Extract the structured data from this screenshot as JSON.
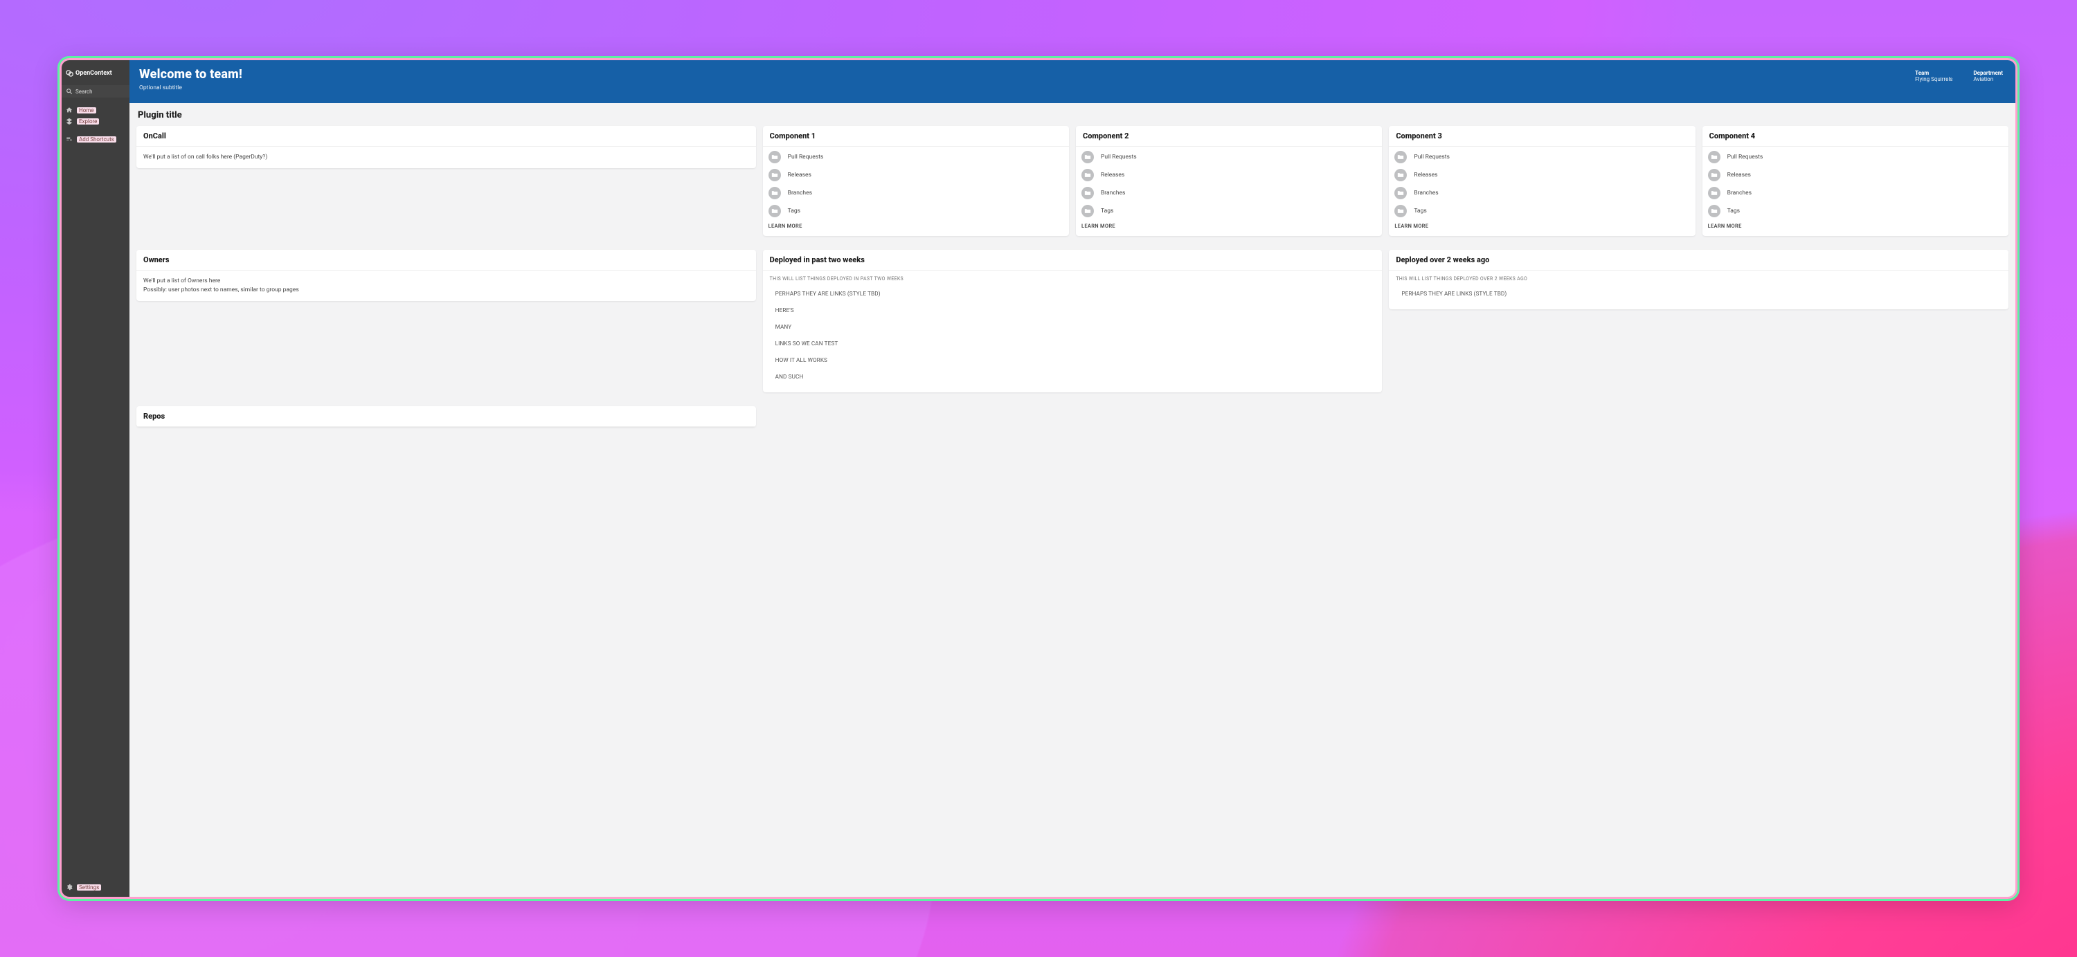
{
  "brand": {
    "name": "OpenContext"
  },
  "sidebar": {
    "search_label": "Search",
    "nav": [
      {
        "label": "Home"
      },
      {
        "label": "Explore"
      }
    ],
    "add_shortcuts": "Add Shortcuts",
    "settings": "Settings"
  },
  "header": {
    "title": "Welcome to team!",
    "subtitle": "Optional subtitle",
    "meta": [
      {
        "key": "Team",
        "value": "Flying Squirrels"
      },
      {
        "key": "Department",
        "value": "Aviation"
      }
    ]
  },
  "plugin_title": "Plugin title",
  "oncall": {
    "title": "OnCall",
    "body": "We'll put a list of on call folks here (PagerDuty?)"
  },
  "component_row_labels": {
    "pull_requests": "Pull Requests",
    "releases": "Releases",
    "branches": "Branches",
    "tags": "Tags"
  },
  "learn_more": "LEARN MORE",
  "components": [
    {
      "title": "Component 1"
    },
    {
      "title": "Component 2"
    },
    {
      "title": "Component 3"
    },
    {
      "title": "Component 4"
    }
  ],
  "owners": {
    "title": "Owners",
    "body1": "We'll put a list of Owners here",
    "body2": "Possibly: user photos next to names, similar to group pages"
  },
  "deployed_recent": {
    "title": "Deployed in past two weeks",
    "overline": "THIS WILL LIST THINGS DEPLOYED IN PAST TWO WEEKS",
    "links": [
      "PERHAPS THEY ARE LINKS (STYLE TBD)",
      "HERE'S",
      "MANY",
      "LINKS SO WE CAN TEST",
      "HOW IT ALL WORKS",
      "AND SUCH"
    ]
  },
  "deployed_old": {
    "title": "Deployed over 2 weeks ago",
    "overline": "THIS WILL LIST THINGS DEPLOYED OVER 2 WEEKS AGO",
    "links": [
      "PERHAPS THEY ARE LINKS (STYLE TBD)"
    ]
  },
  "repos": {
    "title": "Repos"
  }
}
